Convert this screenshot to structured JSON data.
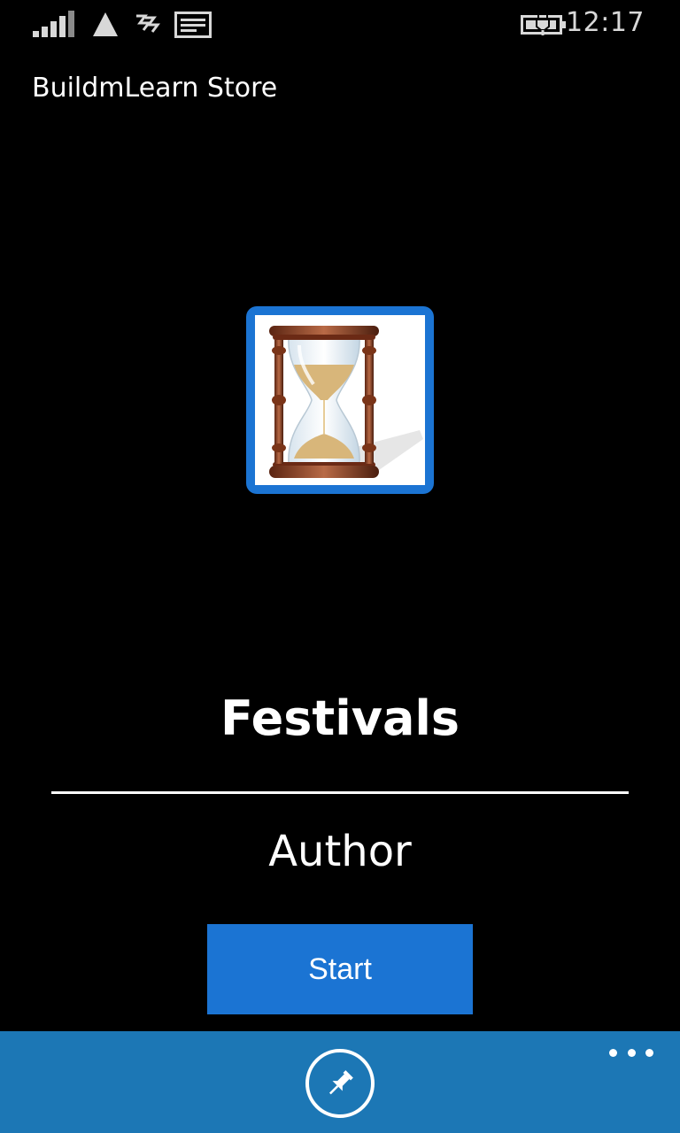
{
  "status_bar": {
    "time": "12:17",
    "icons": [
      "signal-icon",
      "network-triangle-icon",
      "data-wave-icon",
      "message-icon",
      "battery-charging-icon"
    ]
  },
  "app": {
    "title": "BuildmLearn Store"
  },
  "set": {
    "image_icon": "hourglass-icon",
    "title": "Festivals",
    "author": "Author"
  },
  "actions": {
    "start_label": "Start"
  },
  "app_bar": {
    "pin_icon": "pin-icon",
    "more_icon": "more-dots-icon"
  },
  "colors": {
    "accent": "#1b74d3",
    "app_bar": "#1c77b5",
    "background": "#000000"
  }
}
